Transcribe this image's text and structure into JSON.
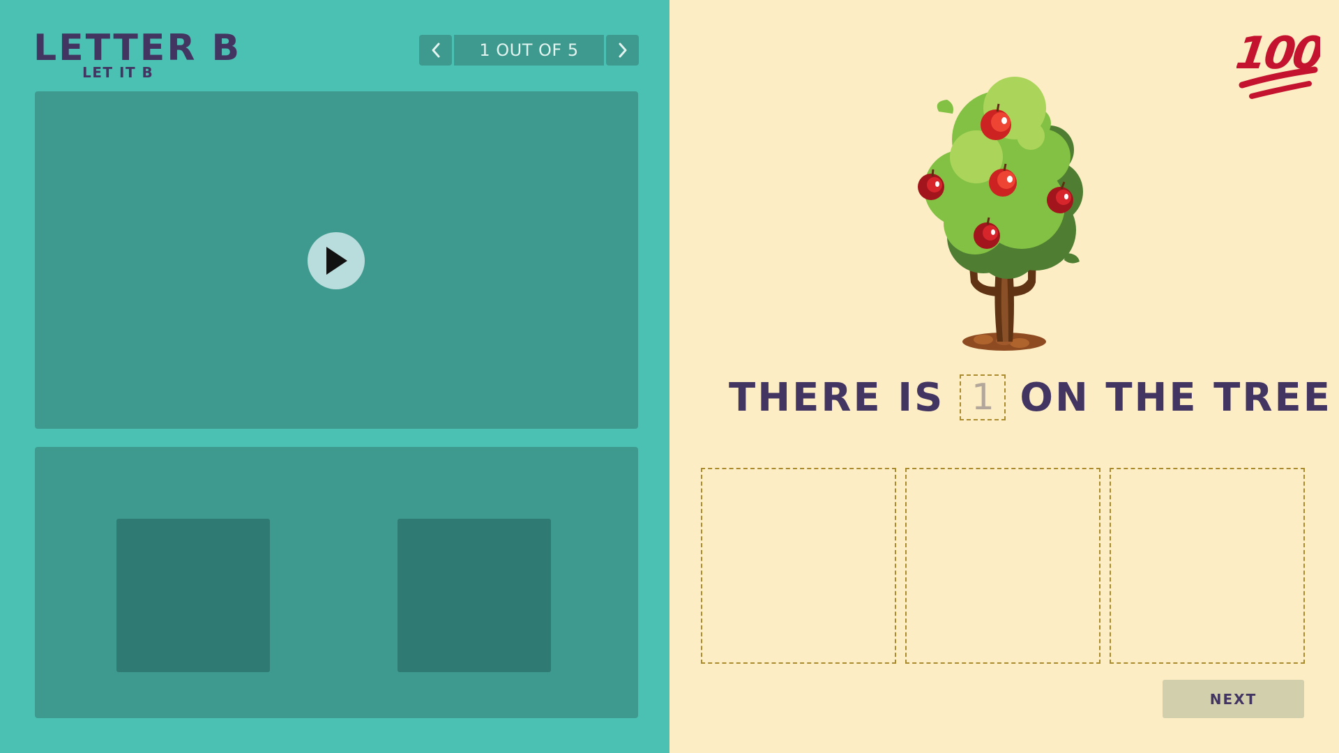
{
  "header": {
    "title": "LETTER B",
    "subtitle": "LET IT B"
  },
  "pager": {
    "label": "1 OUT OF 5",
    "prev_icon": "chevron-left-icon",
    "next_icon": "chevron-right-icon"
  },
  "video": {
    "play_icon": "play-icon"
  },
  "options": {
    "tile_count": 2
  },
  "score_badge": {
    "text": "100",
    "icon": "hundred-points-icon",
    "color": "#c4132f"
  },
  "question": {
    "illustration": "apple-tree-image",
    "prefix": "THERE IS",
    "answer": "1",
    "suffix": "ON THE TREE"
  },
  "drop_zones": {
    "count": 3
  },
  "footer": {
    "next_label": "NEXT"
  },
  "colors": {
    "left_bg": "#4bc1b3",
    "panel": "#3e9a8e",
    "tile": "#2f7a73",
    "right_bg": "#fdedc4",
    "text": "#423562",
    "dashed_border": "#a98a2c",
    "next_button": "#d2cfad"
  }
}
